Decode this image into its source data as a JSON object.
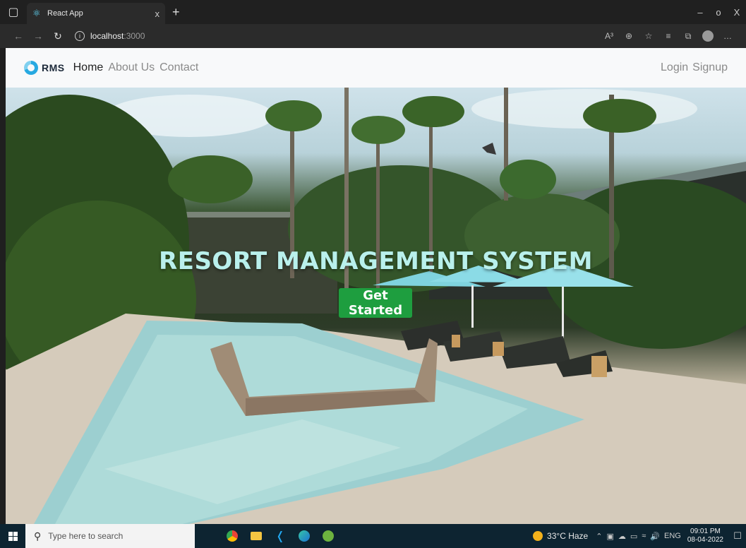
{
  "browser": {
    "tab_title": "React App",
    "tab_close": "x",
    "new_tab": "+",
    "url_host": "localhost",
    "url_port": ":3000",
    "window_controls": [
      "–",
      "o",
      "X"
    ],
    "address_icons": [
      "A³",
      "⊕",
      "☆",
      "≡",
      "⧉",
      "…"
    ]
  },
  "navbar": {
    "brand": "RMS",
    "links": [
      "Home",
      "About Us",
      "Contact"
    ],
    "right_links": [
      "Login",
      "Signup"
    ]
  },
  "hero": {
    "title": "RESORT MANAGEMENT SYSTEM",
    "cta": "Get Started"
  },
  "taskbar": {
    "search_placeholder": "Type here to search",
    "weather": "33°C  Haze",
    "language": "ENG",
    "time": "09:01 PM",
    "date": "08-04-2022"
  },
  "colors": {
    "cta_bg": "#1e9e3f",
    "hero_title": "#b9f0ec",
    "brand_accent": "#27a9e1",
    "taskbar_bg": "#0d2431"
  }
}
